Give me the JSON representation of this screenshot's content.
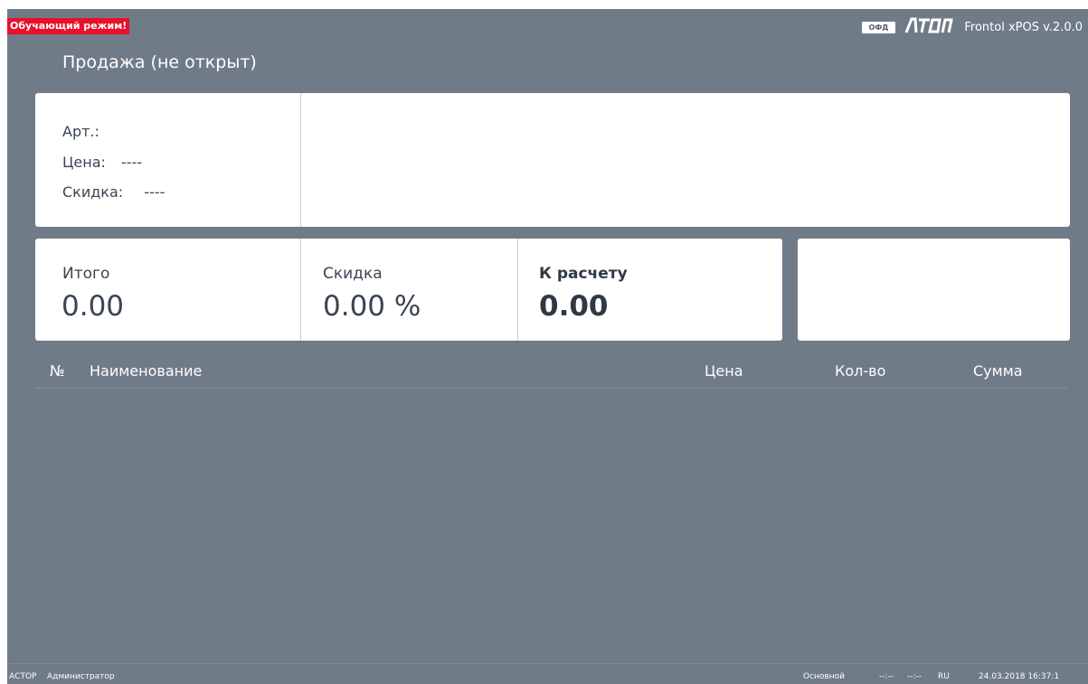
{
  "header": {
    "training_mode": "Обучающий режим!",
    "ofd_badge": "ОФД",
    "logo_text": "ATON",
    "app_version": "Frontol xPOS v.2.0.0"
  },
  "title": "Продажа (не открыт)",
  "item_info": {
    "article_label": "Арт.:",
    "article_value": "",
    "price_label": "Цена:",
    "price_value": "----",
    "discount_label": "Скидка:",
    "discount_value": "----"
  },
  "totals": {
    "total_label": "Итого",
    "total_value": "0.00",
    "discount_label": "Скидка",
    "discount_value": "0.00 %",
    "due_label": "К расчету",
    "due_value": "0.00"
  },
  "table": {
    "columns": [
      "№",
      "Наименование",
      "Цена",
      "Кол-во",
      "Сумма"
    ],
    "rows": []
  },
  "status_bar": {
    "company": "АСТОР",
    "user": "Администратор",
    "mode": "Основной",
    "time1": "--:--",
    "time2": "--:--",
    "lang": "RU",
    "datetime": "24.03.2018 16:37:1"
  },
  "colors": {
    "background": "#707b88",
    "training_badge": "#e8102a",
    "card": "#ffffff"
  }
}
